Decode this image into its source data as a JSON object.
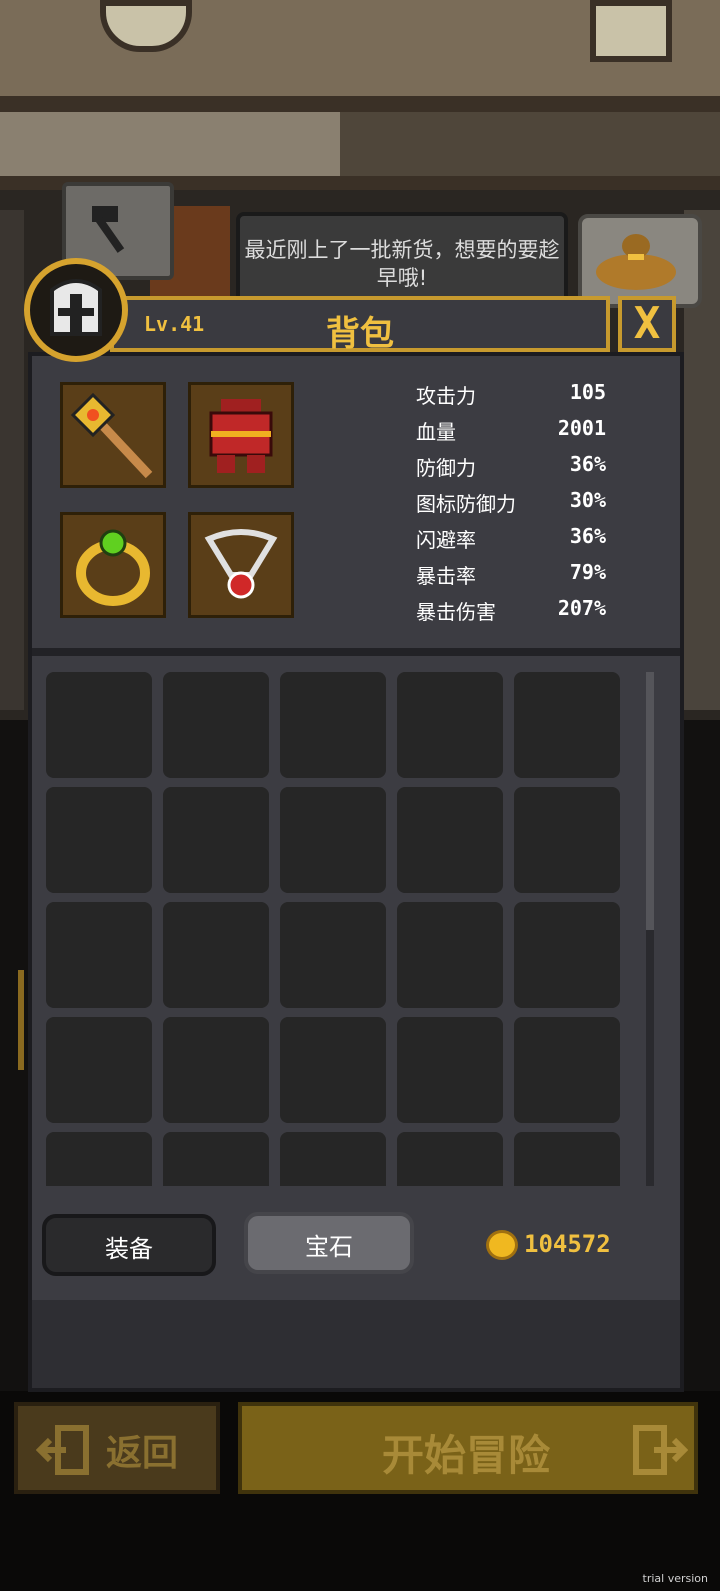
{
  "npc": {
    "speech": "最近刚上了一批新货，想要的要趁早哦!"
  },
  "header": {
    "level": "Lv.41",
    "title": "背包",
    "close": "X"
  },
  "stats": [
    {
      "name": "攻击力",
      "value": "105"
    },
    {
      "name": "血量",
      "value": "2001"
    },
    {
      "name": "防御力",
      "value": "36%"
    },
    {
      "name": "图标防御力",
      "value": "30%"
    },
    {
      "name": "闪避率",
      "value": "36%"
    },
    {
      "name": "暴击率",
      "value": "79%"
    },
    {
      "name": "暴击伤害",
      "value": "207%"
    }
  ],
  "tabs": {
    "equip": "装备",
    "gem": "宝石"
  },
  "gold": "104572",
  "bottom": {
    "back": "返回",
    "start": "开始冒险"
  },
  "watermark": "trial version",
  "colors": {
    "gold": "#f0c040",
    "panel": "#3c3c42",
    "slot": "#262626"
  }
}
